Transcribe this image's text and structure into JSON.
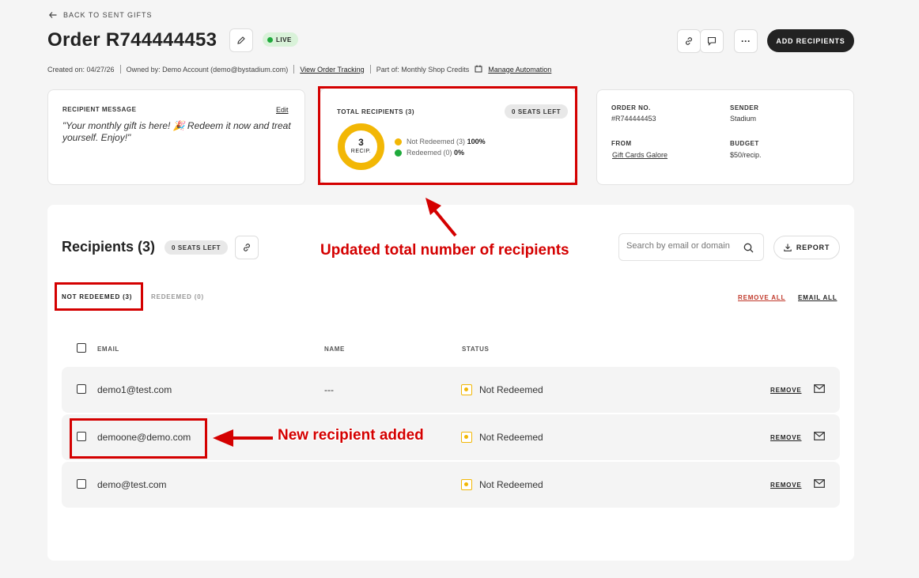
{
  "header": {
    "back_label": "BACK TO SENT GIFTS",
    "title": "Order R744444453",
    "status": "LIVE",
    "add_recipients_label": "ADD RECIPIENTS",
    "more_label": "···"
  },
  "meta": {
    "created": "Created on: 04/27/26",
    "owned_by": "Owned by: Demo Account (demo@bystadium.com)",
    "view_tracking": "View Order Tracking",
    "part_of": "Part of: Monthly Shop Credits",
    "manage_automation": "Manage Automation"
  },
  "message_card": {
    "label": "RECIPIENT MESSAGE",
    "edit_label": "Edit",
    "message": "\"Your monthly gift is here! 🎉 Redeem it now and treat yourself. Enjoy!\""
  },
  "totals_card": {
    "label": "TOTAL RECIPIENTS (3)",
    "seats_left": "0 SEATS LEFT",
    "donut_count": "3",
    "donut_unit": "RECIP.",
    "legend": [
      {
        "label": "Not Redeemed (3)",
        "value": "100%",
        "color": "#f2b705"
      },
      {
        "label": "Redeemed (0)",
        "value": "0%",
        "color": "#1faa3c"
      }
    ]
  },
  "order_card": {
    "order_no_label": "ORDER NO.",
    "order_no": "#R744444453",
    "sender_label": "SENDER",
    "sender": "Stadium",
    "from_label": "FROM",
    "from": "Gift Cards Galore",
    "budget_label": "BUDGET",
    "budget": "$50/recip."
  },
  "recipients": {
    "title": "Recipients (3)",
    "seats_left": "0 SEATS LEFT",
    "search_placeholder": "Search by email or domain",
    "report_label": "REPORT",
    "tabs": [
      {
        "label": "NOT REDEEMED (3)",
        "active": true
      },
      {
        "label": "REDEEMED (0)",
        "active": false
      }
    ],
    "remove_all": "REMOVE ALL",
    "email_all": "EMAIL ALL",
    "columns": {
      "email": "EMAIL",
      "name": "NAME",
      "status": "STATUS"
    },
    "rows": [
      {
        "email": "demo1@test.com",
        "name": "---",
        "status": "Not Redeemed",
        "remove": "REMOVE"
      },
      {
        "email": "demoone@demo.com",
        "name": "",
        "status": "Not Redeemed",
        "remove": "REMOVE"
      },
      {
        "email": "demo@test.com",
        "name": "",
        "status": "Not Redeemed",
        "remove": "REMOVE"
      }
    ]
  },
  "annotations": {
    "total_note": "Updated total number of recipients",
    "new_note": "New recipient added"
  },
  "colors": {
    "accent_red": "#d40000",
    "live_green": "#1faa3c",
    "pending_yellow": "#f2b705",
    "remove_all_red": "#c0392b"
  }
}
